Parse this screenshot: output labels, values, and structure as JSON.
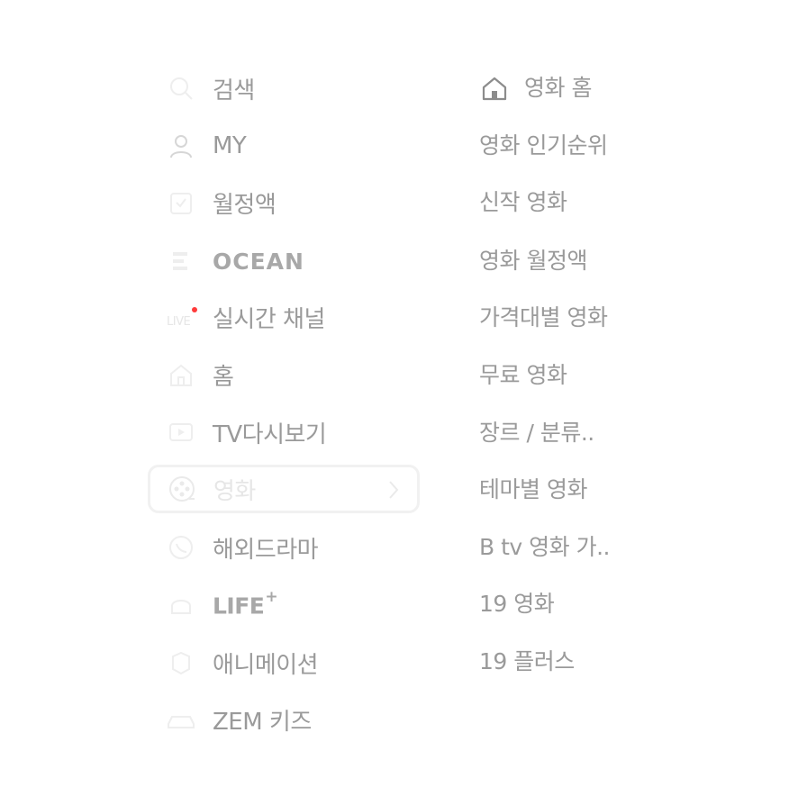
{
  "main_menu": {
    "items": [
      {
        "label": "검색",
        "icon": "search-icon"
      },
      {
        "label": "MY",
        "icon": "user-icon"
      },
      {
        "label": "월정액",
        "icon": "subscription-icon"
      },
      {
        "label": "OCEAN",
        "icon": "ocean-icon"
      },
      {
        "label": "실시간 채널",
        "icon": "live-icon",
        "badge_color": "#ff3b3b"
      },
      {
        "label": "홈",
        "icon": "home-icon"
      },
      {
        "label": "TV다시보기",
        "icon": "tv-replay-icon"
      },
      {
        "label": "영화",
        "icon": "movie-reel-icon",
        "selected": true
      },
      {
        "label": "해외드라마",
        "icon": "globe-drama-icon"
      },
      {
        "label": "LIFE",
        "superscript": "+",
        "icon": "life-icon"
      },
      {
        "label": "애니메이션",
        "icon": "animation-icon"
      },
      {
        "label": "ZEM 키즈",
        "icon": "kids-car-icon"
      }
    ]
  },
  "sub_menu": {
    "items": [
      {
        "label": "영화 홈",
        "icon": "home-icon"
      },
      {
        "label": "영화 인기순위"
      },
      {
        "label": "신작 영화"
      },
      {
        "label": "영화 월정액"
      },
      {
        "label": "가격대별 영화"
      },
      {
        "label": "무료 영화"
      },
      {
        "label": "장르 / 분류.."
      },
      {
        "label": "테마별 영화"
      },
      {
        "label": "B tv 영화 가.."
      },
      {
        "label": "19 영화"
      },
      {
        "label": "19 플러스"
      }
    ]
  },
  "colors": {
    "text": "#9a9a9a",
    "faint_icon": "#efefef",
    "selected_border": "#f1f1f1",
    "live_badge": "#ff3b3b"
  }
}
